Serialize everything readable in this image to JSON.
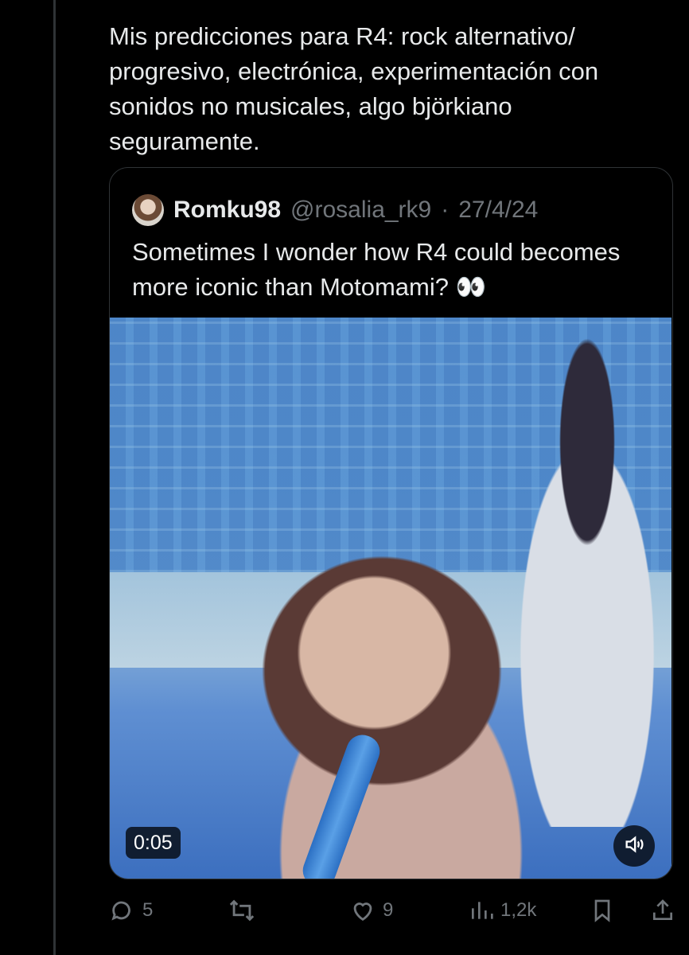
{
  "tweet": {
    "text": "Mis predicciones para R4: rock alternativo/ progresivo, electrónica, experimentación con sonidos no musicales, algo björkiano seguramente."
  },
  "quote": {
    "name": "Romku98",
    "handle": "@rosalia_rk9",
    "separator": "·",
    "date": "27/4/24",
    "text": "Sometimes I wonder how R4 could becomes more iconic than Motomami? 👀",
    "video": {
      "time": "0:05",
      "mute_icon": "speaker-icon"
    }
  },
  "actions": {
    "replies": "5",
    "reposts": "",
    "likes": "9",
    "views": "1,2k"
  },
  "colors": {
    "background": "#000000",
    "text": "#e7e9ea",
    "muted": "#71767b",
    "border": "#2f3336"
  }
}
